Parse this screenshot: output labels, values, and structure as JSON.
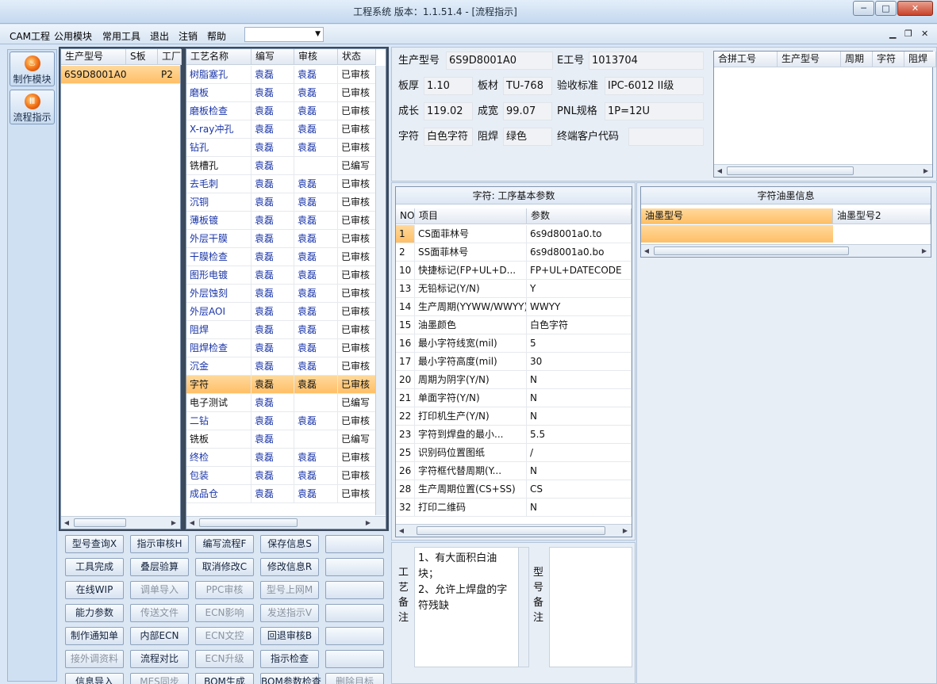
{
  "window": {
    "title": "工程系统   版本：1.1.51.4 - [流程指示]"
  },
  "menu": {
    "items": [
      "CAM工程",
      "公用模块",
      "常用工具",
      "退出",
      "注销",
      "帮助"
    ],
    "combo_value": ""
  },
  "nav": {
    "items": [
      {
        "label": "制作模块",
        "icon": "fire-icon"
      },
      {
        "label": "流程指示",
        "icon": "flow-icon"
      }
    ]
  },
  "model_list": {
    "headers": [
      "生产型号",
      "S板",
      "工厂"
    ],
    "rows": [
      [
        "6S9D8001A0",
        "",
        "P2"
      ]
    ]
  },
  "process_table": {
    "headers": [
      "工艺名称",
      "编写",
      "审核",
      "状态"
    ],
    "rows": [
      [
        "树脂塞孔",
        "袁磊",
        "袁磊",
        "已审核"
      ],
      [
        "磨板",
        "袁磊",
        "袁磊",
        "已审核"
      ],
      [
        "磨板检查",
        "袁磊",
        "袁磊",
        "已审核"
      ],
      [
        "X-ray冲孔",
        "袁磊",
        "袁磊",
        "已审核"
      ],
      [
        "钻孔",
        "袁磊",
        "袁磊",
        "已审核"
      ],
      [
        "铣槽孔",
        "袁磊",
        "",
        "已编写"
      ],
      [
        "去毛刺",
        "袁磊",
        "袁磊",
        "已审核"
      ],
      [
        "沉铜",
        "袁磊",
        "袁磊",
        "已审核"
      ],
      [
        "薄板镀",
        "袁磊",
        "袁磊",
        "已审核"
      ],
      [
        "外层干膜",
        "袁磊",
        "袁磊",
        "已审核"
      ],
      [
        "干膜检查",
        "袁磊",
        "袁磊",
        "已审核"
      ],
      [
        "图形电镀",
        "袁磊",
        "袁磊",
        "已审核"
      ],
      [
        "外层蚀刻",
        "袁磊",
        "袁磊",
        "已审核"
      ],
      [
        "外层AOI",
        "袁磊",
        "袁磊",
        "已审核"
      ],
      [
        "阻焊",
        "袁磊",
        "袁磊",
        "已审核"
      ],
      [
        "阻焊检查",
        "袁磊",
        "袁磊",
        "已审核"
      ],
      [
        "沉金",
        "袁磊",
        "袁磊",
        "已审核"
      ],
      [
        "字符",
        "袁磊",
        "袁磊",
        "已审核"
      ],
      [
        "电子测试",
        "袁磊",
        "",
        "已编写"
      ],
      [
        "二钻",
        "袁磊",
        "袁磊",
        "已审核"
      ],
      [
        "铣板",
        "袁磊",
        "",
        "已编写"
      ],
      [
        "终检",
        "袁磊",
        "袁磊",
        "已审核"
      ],
      [
        "包装",
        "袁磊",
        "袁磊",
        "已审核"
      ],
      [
        "成品仓",
        "袁磊",
        "袁磊",
        "已审核"
      ]
    ]
  },
  "buttons": [
    [
      "型号查询X",
      "指示审核H",
      "编写流程F",
      "保存信息S",
      ""
    ],
    [
      "工具完成",
      "叠层验算",
      "取消修改C",
      "修改信息R",
      ""
    ],
    [
      "在线WIP",
      "调单导入",
      "PPC审核",
      "型号上网M",
      ""
    ],
    [
      "能力参数",
      "传送文件",
      "ECN影响",
      "发送指示V",
      ""
    ],
    [
      "制作通知单",
      "内部ECN",
      "ECN文控",
      "回退审核B",
      ""
    ],
    [
      "接外调资料",
      "流程对比",
      "ECN升级",
      "指示检查",
      ""
    ],
    [
      "信息导入",
      "MES同步",
      "BOM生成",
      "BOM参数检查",
      "删除目标"
    ]
  ],
  "info": {
    "model_label": "生产型号",
    "model": "6S9D8001A0",
    "eno_label": "E工号",
    "eno": "1013704",
    "thick_label": "板厚",
    "thick": "1.10",
    "mat_label": "板材",
    "mat": "TU-768",
    "std_label": "验收标准",
    "std": "IPC-6012 II级",
    "len_label": "成长",
    "len": "119.02",
    "wid_label": "成宽",
    "wid": "99.07",
    "pnl_label": "PNL规格",
    "pnl": "1P=12U",
    "char_label": "字符",
    "char": "白色字符",
    "mask_label": "阻焊",
    "mask": "绿色",
    "cust_label": "终端客户代码",
    "cust": ""
  },
  "merge_table": {
    "headers": [
      "合拼工号",
      "生产型号",
      "周期",
      "字符",
      "阻焊"
    ]
  },
  "params": {
    "title": "字符: 工序基本参数",
    "headers": [
      "NO",
      "项目",
      "参数"
    ],
    "rows": [
      [
        "1",
        "CS面菲林号",
        "6s9d8001a0.to"
      ],
      [
        "2",
        "SS面菲林号",
        "6s9d8001a0.bo"
      ],
      [
        "10",
        "快捷标记(FP+UL+D...",
        "FP+UL+DATECODE"
      ],
      [
        "13",
        "无铅标记(Y/N)",
        "Y"
      ],
      [
        "14",
        "生产周期(YYWW/WWYY)",
        "WWYY"
      ],
      [
        "15",
        "油墨颜色",
        "白色字符"
      ],
      [
        "16",
        "最小字符线宽(mil)",
        "5"
      ],
      [
        "17",
        "最小字符高度(mil)",
        "30"
      ],
      [
        "20",
        "周期为阴字(Y/N)",
        "N"
      ],
      [
        "21",
        "单面字符(Y/N)",
        "N"
      ],
      [
        "22",
        "打印机生产(Y/N)",
        "N"
      ],
      [
        "23",
        "字符到焊盘的最小...",
        "5.5"
      ],
      [
        "25",
        "识别码位置图纸",
        "/"
      ],
      [
        "26",
        "字符框代替周期(Y...",
        "N"
      ],
      [
        "28",
        "生产周期位置(CS+SS)",
        "CS"
      ],
      [
        "32",
        "打印二维码",
        "N"
      ]
    ]
  },
  "ink": {
    "title": "字符油墨信息",
    "headers": [
      "油墨型号",
      "油墨型号2"
    ]
  },
  "remarks": {
    "proc_label": [
      "工",
      "艺",
      "备",
      "注"
    ],
    "proc_text": "1、有大面积白油块；\n2、允许上焊盘的字符残缺",
    "model_label": [
      "型",
      "号",
      "备",
      "注"
    ],
    "model_text": ""
  }
}
